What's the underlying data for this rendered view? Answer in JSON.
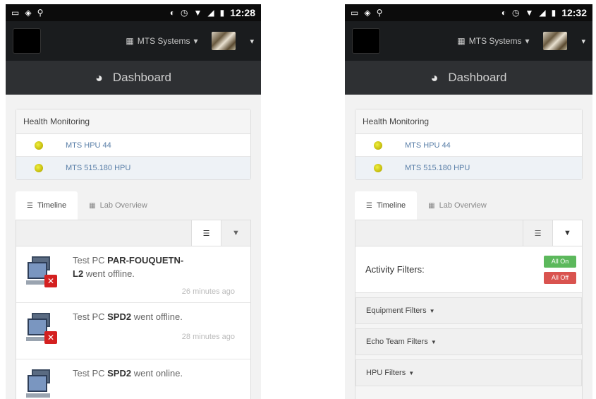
{
  "status_left": {
    "time": "12:28"
  },
  "status_right": {
    "time": "12:32"
  },
  "navbar": {
    "org_name": "MTS Systems",
    "org_caret": "▾",
    "user_caret": "▾"
  },
  "dashboard": {
    "title": "Dashboard"
  },
  "health": {
    "title": "Health Monitoring",
    "items": [
      {
        "label": "MTS HPU 44",
        "status_color": "#c8c010"
      },
      {
        "label": "MTS 515.180 HPU",
        "status_color": "#c8c010"
      }
    ]
  },
  "tabs": [
    {
      "label": "Timeline",
      "icon": "list-icon"
    },
    {
      "label": "Lab Overview",
      "icon": "grid-icon"
    }
  ],
  "timeline": [
    {
      "prefix": "Test PC ",
      "pc": "PAR-FOUQUETN-L2",
      "suffix": " went offline.",
      "time": "26 minutes ago",
      "status": "offline"
    },
    {
      "prefix": "Test PC ",
      "pc": "SPD2",
      "suffix": " went offline.",
      "time": "28 minutes ago",
      "status": "offline"
    },
    {
      "prefix": "Test PC ",
      "pc": "SPD2",
      "suffix": " went online.",
      "time": "",
      "status": "online"
    }
  ],
  "filters": {
    "title": "Activity Filters:",
    "all_on": "All On",
    "all_off": "All Off",
    "groups": [
      {
        "label": "Equipment Filters"
      },
      {
        "label": "Echo Team Filters"
      },
      {
        "label": "HPU Filters"
      }
    ]
  },
  "colors": {
    "navbar": "#1a1c1e",
    "dashbar": "#2e3033",
    "link": "#5a7fa8",
    "on": "#5cb85c",
    "off": "#d9534f"
  }
}
